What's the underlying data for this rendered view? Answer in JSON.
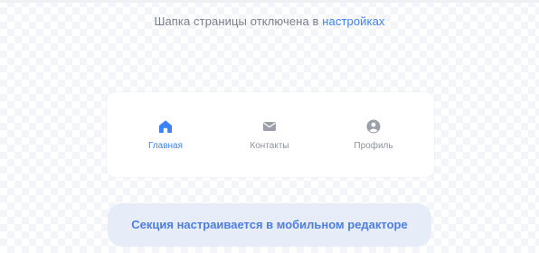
{
  "header_notice": {
    "text": "Шапка страницы отключена в ",
    "link_label": "настройках"
  },
  "tabbar": {
    "tabs": [
      {
        "label": "Главная",
        "icon": "home-icon",
        "active": true
      },
      {
        "label": "Контакты",
        "icon": "envelope-icon",
        "active": false
      },
      {
        "label": "Профиль",
        "icon": "user-circle-icon",
        "active": false
      }
    ]
  },
  "section_note": {
    "text": "Секция настраивается в мобильном редакторе"
  },
  "colors": {
    "accent": "#3b82f6",
    "inactive_icon": "#9ca0aa",
    "note_background": "#e6ecf8",
    "note_text": "#4d7ee0"
  }
}
